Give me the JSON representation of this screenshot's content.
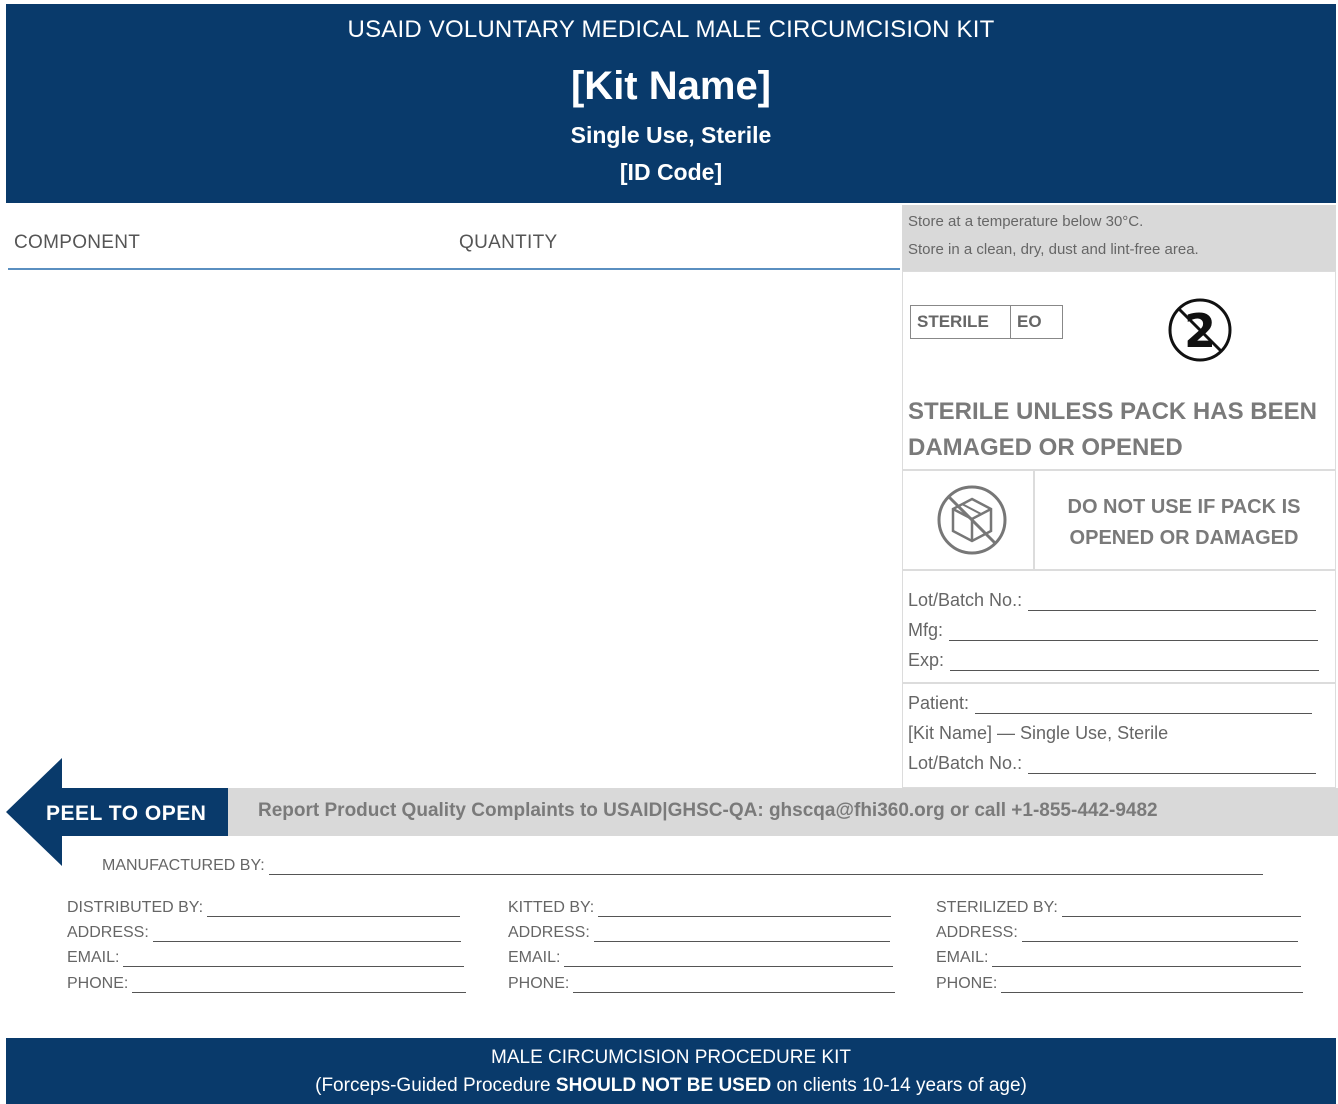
{
  "header": {
    "top_line": "USAID VOLUNTARY MEDICAL MALE CIRCUMCISION KIT",
    "kit_name": "[Kit Name]",
    "subtitle": "Single Use, Sterile",
    "id_code": "[ID Code]"
  },
  "table": {
    "component_label": "COMPONENT",
    "quantity_label": "QUANTITY"
  },
  "storage": {
    "line1": "Store at a temperature below 30°C.",
    "line2": "Store in a clean, dry, dust and lint-free area."
  },
  "sterile": {
    "badge_left": "STERILE",
    "badge_right": "EO",
    "do_not_reuse_number": "2",
    "warning": "STERILE UNLESS PACK HAS BEEN DAMAGED OR OPENED",
    "pack_warning_line1": "DO NOT USE IF PACK IS",
    "pack_warning_line2": "OPENED OR DAMAGED"
  },
  "lot_fields": {
    "lot": "Lot/Batch No.:",
    "mfg": "Mfg:",
    "exp": "Exp:"
  },
  "patient_fields": {
    "patient": "Patient:",
    "kit_line": "[Kit Name] — Single Use, Sterile",
    "lot": "Lot/Batch No.:"
  },
  "peel": {
    "label": "PEEL TO OPEN",
    "complaint": "Report Product Quality Complaints to USAID|GHSC-QA: ghscqa@fhi360.org or call +1-855-442-9482"
  },
  "manufacturer": {
    "label": "MANUFACTURED BY:"
  },
  "parties": [
    {
      "title": "DISTRIBUTED BY:",
      "address": "ADDRESS:",
      "email": "EMAIL:",
      "phone": "PHONE:"
    },
    {
      "title": "KITTED BY:",
      "address": "ADDRESS:",
      "email": "EMAIL:",
      "phone": "PHONE:"
    },
    {
      "title": "STERILIZED BY:",
      "address": "ADDRESS:",
      "email": "EMAIL:",
      "phone": "PHONE:"
    }
  ],
  "footer": {
    "line1": "MALE CIRCUMCISION PROCEDURE KIT",
    "line2_pre": "(Forceps-Guided Procedure ",
    "line2_bold": "SHOULD NOT BE USED",
    "line2_post": " on clients 10-14 years of age)"
  },
  "colors": {
    "navy": "#093a6b",
    "gray_band": "#d9d9d9",
    "rule_blue": "#5a8fc0"
  }
}
